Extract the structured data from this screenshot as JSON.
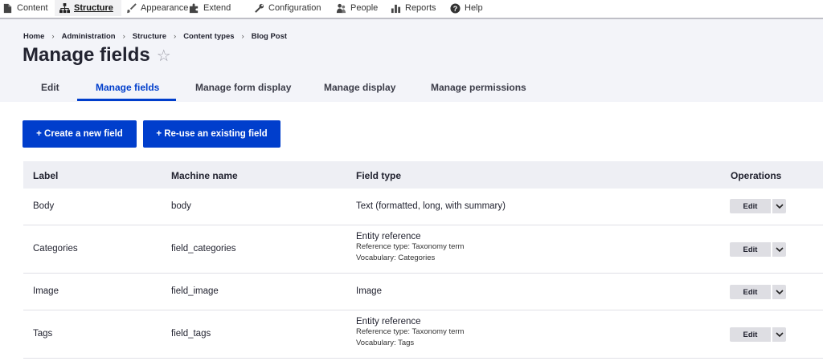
{
  "toolbar": {
    "items": [
      {
        "label": "Content",
        "icon": "file-icon"
      },
      {
        "label": "Structure",
        "icon": "sitemap-icon"
      },
      {
        "label": "Appearance",
        "icon": "brush-icon"
      },
      {
        "label": "Extend",
        "icon": "puzzle-icon"
      },
      {
        "label": "Configuration",
        "icon": "wrench-icon"
      },
      {
        "label": "People",
        "icon": "people-icon"
      },
      {
        "label": "Reports",
        "icon": "bar-chart-icon"
      },
      {
        "label": "Help",
        "icon": "help-icon"
      }
    ],
    "active": "Structure"
  },
  "breadcrumb": [
    "Home",
    "Administration",
    "Structure",
    "Content types",
    "Blog Post"
  ],
  "breadcrumb_separator": "›",
  "page": {
    "title": "Manage fields",
    "star": "☆"
  },
  "tabs": [
    {
      "label": "Edit"
    },
    {
      "label": "Manage fields"
    },
    {
      "label": "Manage form display"
    },
    {
      "label": "Manage display"
    },
    {
      "label": "Manage permissions"
    }
  ],
  "active_tab": "Manage fields",
  "buttons": {
    "create": "+ Create a new field",
    "reuse": "+ Re-use an existing field"
  },
  "table": {
    "headers": [
      "Label",
      "Machine name",
      "Field type",
      "Operations"
    ],
    "rows": [
      {
        "label": "Body",
        "machine": "body",
        "type": "Text (formatted, long, with summary)",
        "details": []
      },
      {
        "label": "Categories",
        "machine": "field_categories",
        "type": "Entity reference",
        "details": [
          "Reference type: Taxonomy term",
          "Vocabulary: Categories"
        ]
      },
      {
        "label": "Image",
        "machine": "field_image",
        "type": "Image",
        "details": []
      },
      {
        "label": "Tags",
        "machine": "field_tags",
        "type": "Entity reference",
        "details": [
          "Reference type: Taxonomy term",
          "Vocabulary: Tags"
        ]
      }
    ],
    "op_label": "Edit"
  },
  "colors": {
    "accent": "#003ecc",
    "header_bg": "#f3f4f9",
    "table_header_bg": "#eeeff4"
  }
}
